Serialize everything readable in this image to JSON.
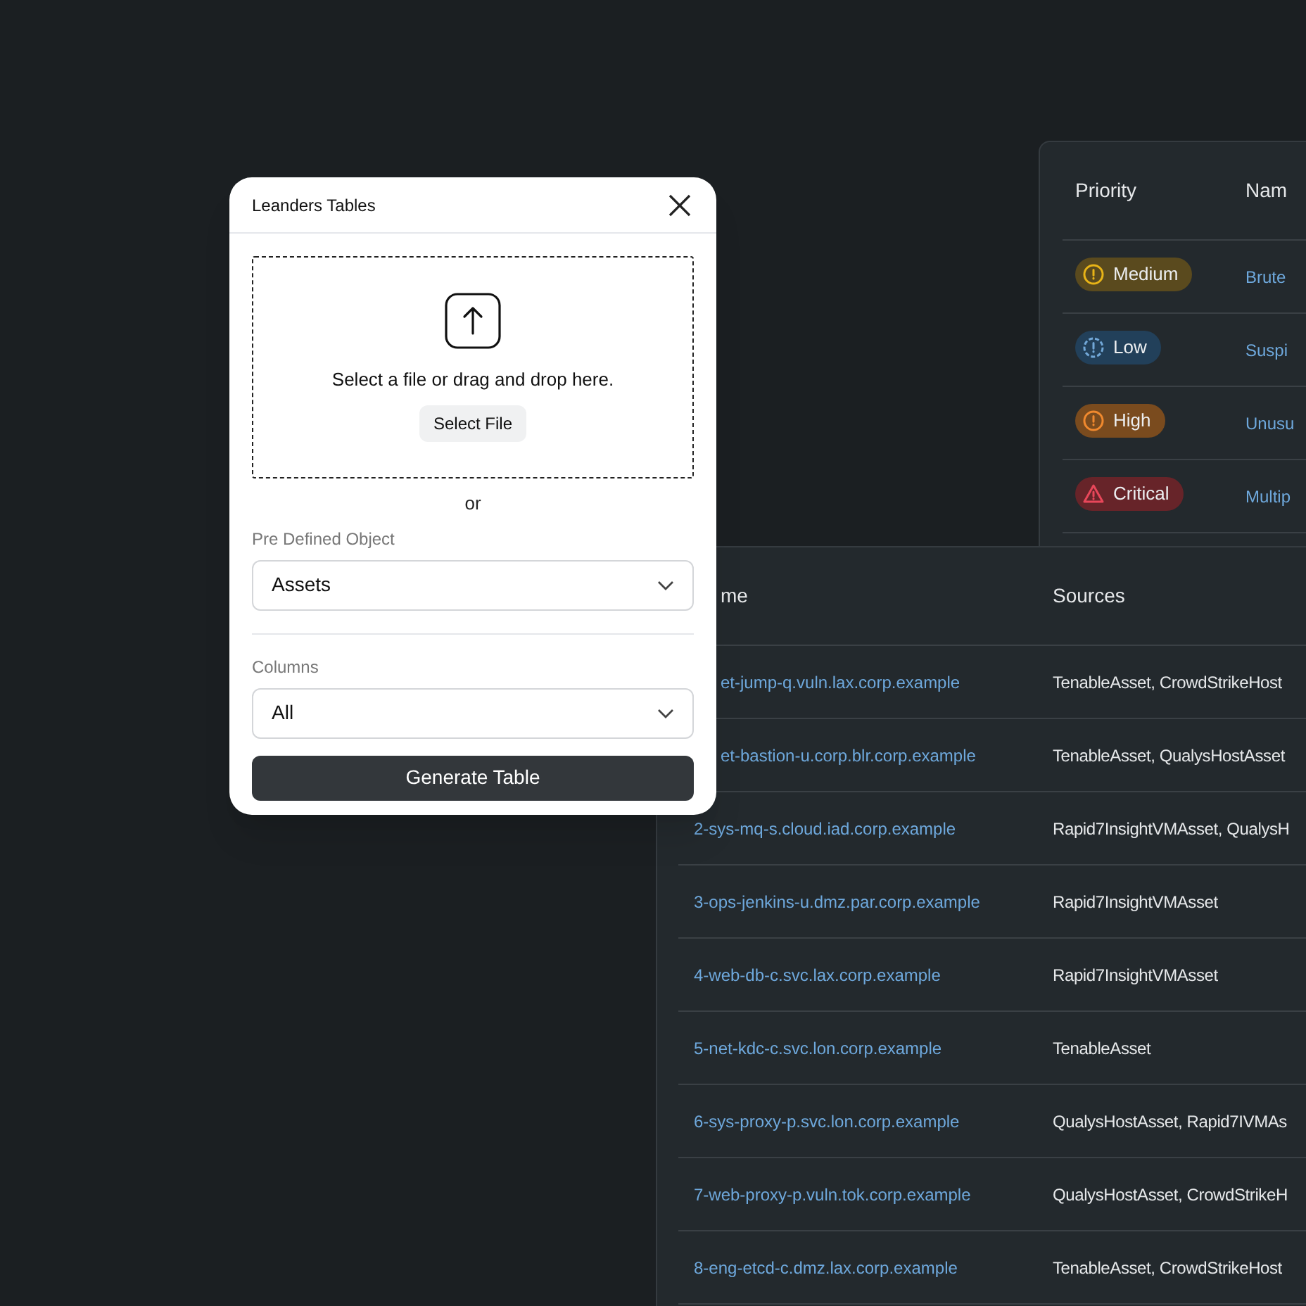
{
  "priority_table": {
    "columns": [
      "Priority",
      "Nam"
    ],
    "rows": [
      {
        "priority": "Medium",
        "kind": "medium",
        "name": "Brute"
      },
      {
        "priority": "Low",
        "kind": "low",
        "name": "Suspi"
      },
      {
        "priority": "High",
        "kind": "high",
        "name": "Unusu"
      },
      {
        "priority": "Critical",
        "kind": "critical",
        "name": "Multip"
      }
    ]
  },
  "assets_table": {
    "columns": [
      "me",
      "Sources"
    ],
    "rows": [
      {
        "name": "et-jump-q.vuln.lax.corp.example",
        "sources": "TenableAsset, CrowdStrikeHost"
      },
      {
        "name": "et-bastion-u.corp.blr.corp.example",
        "sources": "TenableAsset, QualysHostAsset"
      },
      {
        "name": "2-sys-mq-s.cloud.iad.corp.example",
        "sources": "Rapid7InsightVMAsset, QualysH"
      },
      {
        "name": "3-ops-jenkins-u.dmz.par.corp.example",
        "sources": "Rapid7InsightVMAsset"
      },
      {
        "name": "4-web-db-c.svc.lax.corp.example",
        "sources": "Rapid7InsightVMAsset"
      },
      {
        "name": "5-net-kdc-c.svc.lon.corp.example",
        "sources": "TenableAsset"
      },
      {
        "name": "6-sys-proxy-p.svc.lon.corp.example",
        "sources": "QualysHostAsset, Rapid7IVMAs"
      },
      {
        "name": "7-web-proxy-p.vuln.tok.corp.example",
        "sources": "QualysHostAsset, CrowdStrikeH"
      },
      {
        "name": "8-eng-etcd-c.dmz.lax.corp.example",
        "sources": "TenableAsset, CrowdStrikeHost"
      }
    ]
  },
  "dialog": {
    "title": "Leanders Tables",
    "upload_text": "Select a file or drag and drop here.",
    "select_button": "Select File",
    "or": "or",
    "fields": [
      {
        "label": "Pre Defined Object",
        "value": "Assets"
      },
      {
        "label": "Columns",
        "value": "All"
      }
    ],
    "submit": "Generate Table"
  }
}
